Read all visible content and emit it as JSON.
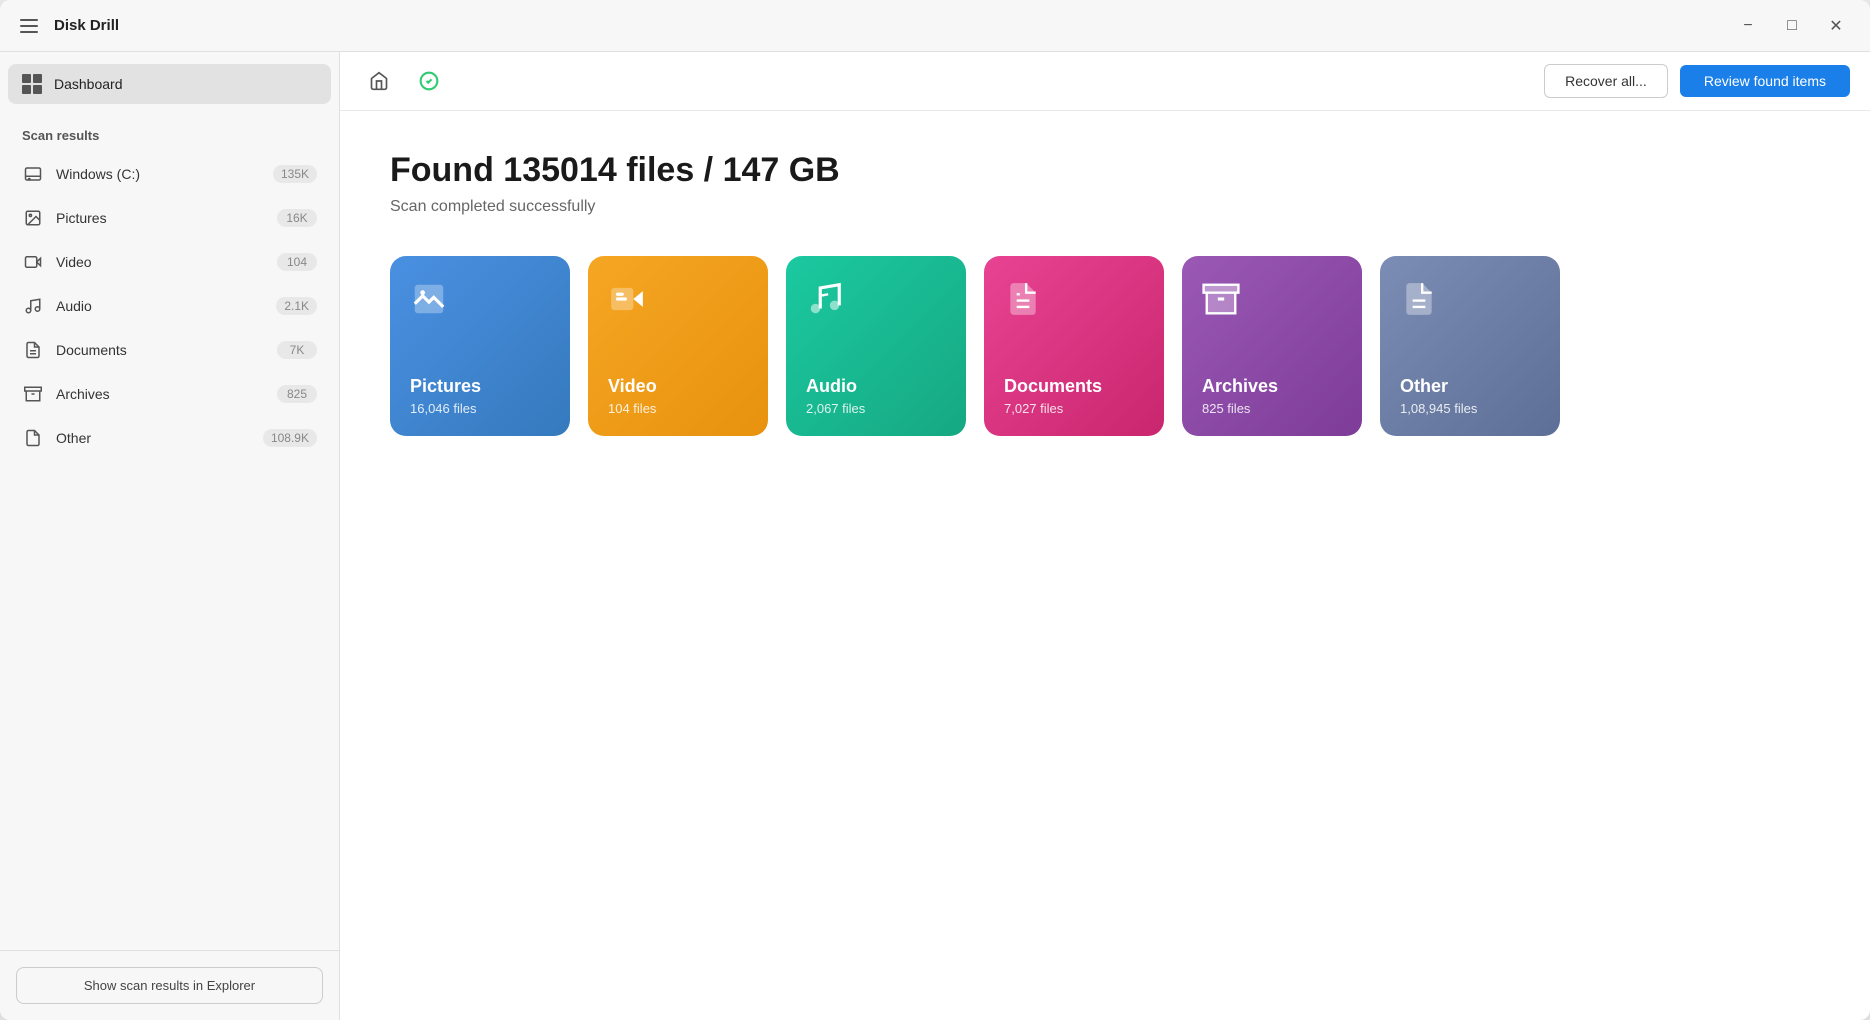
{
  "app": {
    "title": "Disk Drill"
  },
  "titlebar": {
    "minimize_label": "−",
    "maximize_label": "□",
    "close_label": "✕"
  },
  "sidebar": {
    "dashboard_label": "Dashboard",
    "scan_results_header": "Scan results",
    "nav_items": [
      {
        "id": "windows",
        "label": "Windows (C:)",
        "badge": "135K",
        "icon": "drive"
      },
      {
        "id": "pictures",
        "label": "Pictures",
        "badge": "16K",
        "icon": "pictures"
      },
      {
        "id": "video",
        "label": "Video",
        "badge": "104",
        "icon": "video"
      },
      {
        "id": "audio",
        "label": "Audio",
        "badge": "2.1K",
        "icon": "audio"
      },
      {
        "id": "documents",
        "label": "Documents",
        "badge": "7K",
        "icon": "documents"
      },
      {
        "id": "archives",
        "label": "Archives",
        "badge": "825",
        "icon": "archives"
      },
      {
        "id": "other",
        "label": "Other",
        "badge": "108.9K",
        "icon": "other"
      }
    ],
    "show_explorer_btn": "Show scan results in Explorer"
  },
  "toolbar": {
    "recover_all_label": "Recover all...",
    "review_found_label": "Review found items"
  },
  "main": {
    "found_title": "Found 135014 files / 147 GB",
    "found_subtitle": "Scan completed successfully",
    "cards": [
      {
        "id": "pictures",
        "title": "Pictures",
        "subtitle": "16,046 files",
        "color_class": "card-pictures"
      },
      {
        "id": "video",
        "title": "Video",
        "subtitle": "104 files",
        "color_class": "card-video"
      },
      {
        "id": "audio",
        "title": "Audio",
        "subtitle": "2,067 files",
        "color_class": "card-audio"
      },
      {
        "id": "documents",
        "title": "Documents",
        "subtitle": "7,027 files",
        "color_class": "card-documents"
      },
      {
        "id": "archives",
        "title": "Archives",
        "subtitle": "825 files",
        "color_class": "card-archives"
      },
      {
        "id": "other",
        "title": "Other",
        "subtitle": "1,08,945 files",
        "color_class": "card-other"
      }
    ]
  }
}
